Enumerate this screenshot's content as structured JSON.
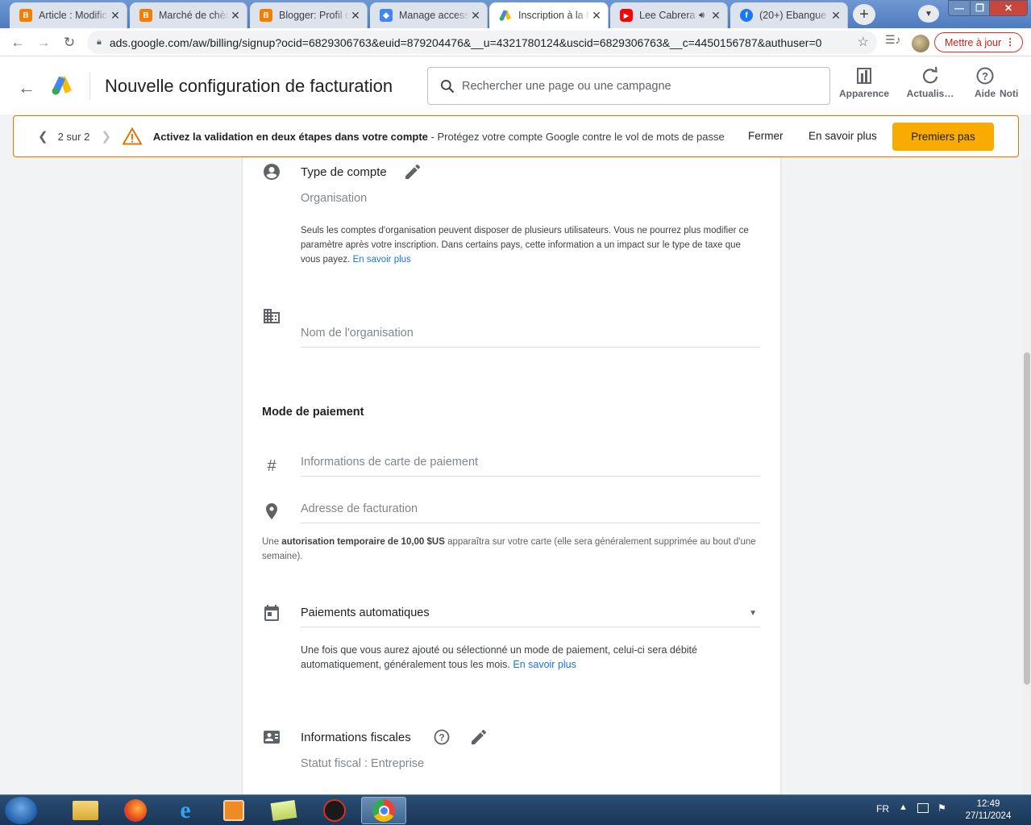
{
  "browser": {
    "tabs": [
      {
        "title": "Article : Modific",
        "favicon": "blogger-icon",
        "color": "#f57d00"
      },
      {
        "title": "Marché de chèq",
        "favicon": "blogger-icon",
        "color": "#f57d00"
      },
      {
        "title": "Blogger: Profil d",
        "favicon": "blogger-icon",
        "color": "#f57d00"
      },
      {
        "title": "Manage access",
        "favicon": "google-admin-icon",
        "color": "#4285f4"
      },
      {
        "title": "Inscription à la f",
        "favicon": "google-ads-icon",
        "color": "#fbbc04",
        "active": true
      },
      {
        "title": "Lee Cabrera",
        "favicon": "youtube-icon",
        "color": "#ff0000",
        "audio": true
      },
      {
        "title": "(20+) Ebangue",
        "favicon": "facebook-icon",
        "color": "#1877f2"
      }
    ],
    "url": "ads.google.com/aw/billing/signup?ocid=6829306763&euid=879204476&__u=4321780124&uscid=6829306763&__c=4450156787&authuser=0",
    "update_label": "Mettre à jour"
  },
  "header": {
    "title": "Nouvelle configuration de facturation",
    "search_placeholder": "Rechercher une page ou une campagne",
    "tools": [
      {
        "label": "Apparence",
        "icon": "appearance-icon"
      },
      {
        "label": "Actualis…",
        "icon": "refresh-icon"
      },
      {
        "label": "Aide",
        "icon": "help-icon"
      },
      {
        "label": "Noti",
        "icon": "notifications-icon"
      }
    ]
  },
  "banner": {
    "counter": "2 sur 2",
    "message_bold": "Activez la validation en deux étapes dans votre compte",
    "message_rest": " - Protégez votre compte Google contre le vol de mots de passe",
    "close_label": "Fermer",
    "learn_more_label": "En savoir plus",
    "cta_label": "Premiers pas"
  },
  "form": {
    "account_type": {
      "label": "Type de compte",
      "value": "Organisation",
      "description": "Seuls les comptes d'organisation peuvent disposer de plusieurs utilisateurs. Vous ne pourrez plus modifier ce paramètre après votre inscription. Dans certains pays, cette information a un impact sur le type de taxe que vous payez.",
      "link": "En savoir plus"
    },
    "organization_name": {
      "placeholder": "Nom de l'organisation"
    },
    "payment_method": {
      "title": "Mode de paiement",
      "card_placeholder": "Informations de carte de paiement",
      "address_placeholder": "Adresse de facturation",
      "auth_prefix": "Une ",
      "auth_bold": "autorisation temporaire de 10,00 $US",
      "auth_suffix": " apparaîtra sur votre carte (elle sera généralement supprimée au bout d'une semaine)."
    },
    "auto_payments": {
      "label": "Paiements automatiques",
      "description": "Une fois que vous aurez ajouté ou sélectionné un mode de paiement, celui-ci sera débité automatiquement, généralement tous les mois.",
      "link": "En savoir plus"
    },
    "tax_info": {
      "label": "Informations fiscales",
      "status": "Statut fiscal : Entreprise"
    }
  },
  "taskbar": {
    "language": "FR",
    "time": "12:49",
    "date": "27/11/2024"
  },
  "colors": {
    "accent": "#1a73e8",
    "warning": "#e37400",
    "cta": "#f9ab00"
  }
}
